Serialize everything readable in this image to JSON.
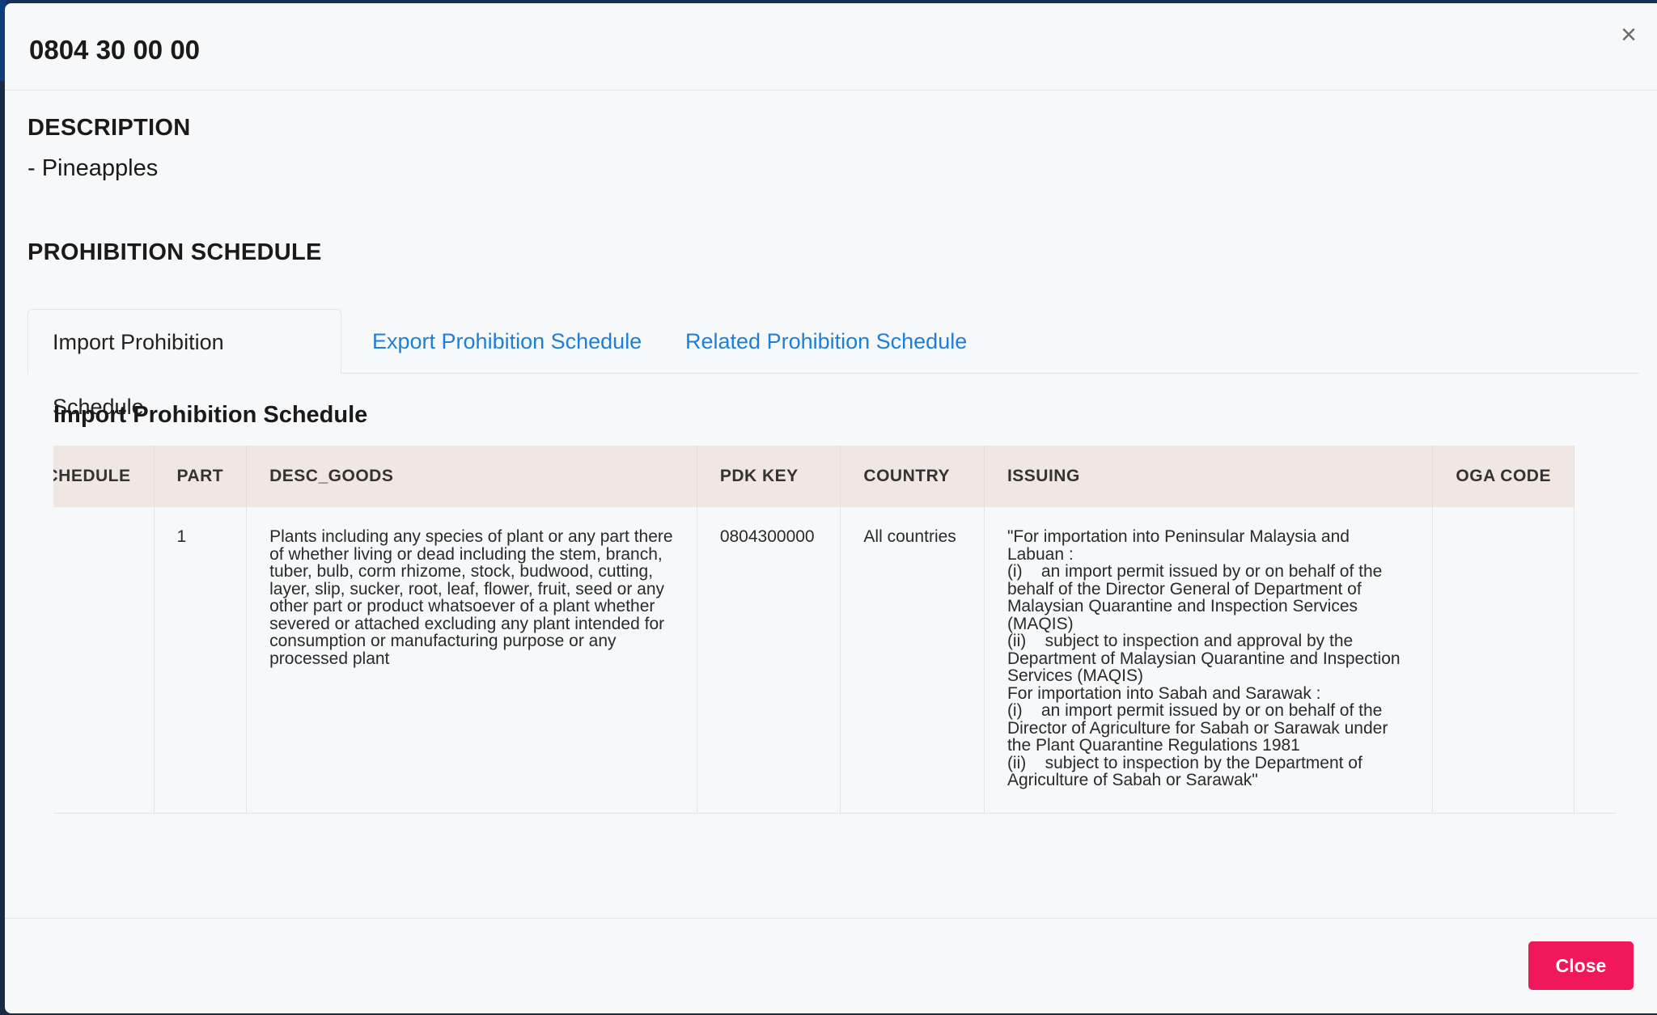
{
  "modal": {
    "title": "0804 30 00 00",
    "close_icon": "×"
  },
  "description": {
    "heading": "DESCRIPTION",
    "text": "- Pineapples"
  },
  "prohibition": {
    "heading": "PROHIBITION SCHEDULE",
    "tabs": [
      {
        "label": "Import Prohibition Schedule",
        "active": true
      },
      {
        "label": "Export Prohibition Schedule",
        "active": false
      },
      {
        "label": "Related Prohibition Schedule",
        "active": false
      }
    ],
    "subheading": "Import Prohibition Schedule"
  },
  "table": {
    "columns": [
      "SCHEDULE",
      "PART",
      "DESC_GOODS",
      "PDK KEY",
      "COUNTRY",
      "ISSUING",
      "OGA CODE"
    ],
    "rows": [
      {
        "schedule": "",
        "part": "1",
        "desc_goods": "Plants including any species of plant or any part there of whether living or dead including the stem, branch, tuber, bulb, corm rhizome, stock, budwood, cutting, layer, slip, sucker, root, leaf, flower, fruit, seed or any other part or product whatsoever of a plant whether severed or attached excluding any plant intended for consumption or manufacturing purpose or any processed plant",
        "pdk_key": "0804300000",
        "country": "All countries",
        "issuing": "\"For importation into Peninsular Malaysia and Labuan :\n(i)    an import permit issued by or on behalf of the behalf of the Director General of Department of Malaysian Quarantine and Inspection Services (MAQIS)\n(ii)    subject to inspection and approval by the Department of Malaysian Quarantine and Inspection Services (MAQIS)\nFor importation into Sabah and Sarawak :\n(i)    an import permit issued by or on behalf of the Director of Agriculture for Sabah or Sarawak under the Plant Quarantine Regulations 1981\n(ii)    subject to inspection by the Department of Agriculture of Sabah or Sarawak\"",
        "oga_code": ""
      }
    ]
  },
  "footer": {
    "close_label": "Close"
  },
  "colors": {
    "accent_link": "#1e7fd8",
    "close_button": "#f0185a",
    "header_row": "#f0e7e3"
  }
}
